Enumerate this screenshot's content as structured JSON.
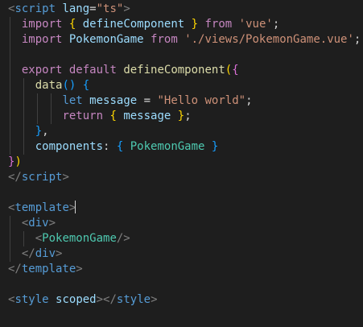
{
  "editor": {
    "language": "vue",
    "cursor_line": 13,
    "lines": [
      {
        "indent": 0,
        "tokens": [
          {
            "t": "<",
            "c": "#808080"
          },
          {
            "t": "script",
            "c": "#569cd6"
          },
          {
            "t": " ",
            "c": "#d4d4d4"
          },
          {
            "t": "lang",
            "c": "#9cdcfe"
          },
          {
            "t": "=",
            "c": "#d4d4d4"
          },
          {
            "t": "\"ts\"",
            "c": "#ce9178"
          },
          {
            "t": ">",
            "c": "#808080"
          }
        ]
      },
      {
        "indent": 1,
        "tokens": [
          {
            "t": "import",
            "c": "#c586c0"
          },
          {
            "t": " ",
            "c": "#d4d4d4"
          },
          {
            "t": "{",
            "c": "#ffd700"
          },
          {
            "t": " ",
            "c": "#d4d4d4"
          },
          {
            "t": "defineComponent",
            "c": "#9cdcfe"
          },
          {
            "t": " ",
            "c": "#d4d4d4"
          },
          {
            "t": "}",
            "c": "#ffd700"
          },
          {
            "t": " ",
            "c": "#d4d4d4"
          },
          {
            "t": "from",
            "c": "#c586c0"
          },
          {
            "t": " ",
            "c": "#d4d4d4"
          },
          {
            "t": "'vue'",
            "c": "#ce9178"
          },
          {
            "t": ";",
            "c": "#d4d4d4"
          }
        ]
      },
      {
        "indent": 1,
        "tokens": [
          {
            "t": "import",
            "c": "#c586c0"
          },
          {
            "t": " ",
            "c": "#d4d4d4"
          },
          {
            "t": "PokemonGame",
            "c": "#9cdcfe"
          },
          {
            "t": " ",
            "c": "#d4d4d4"
          },
          {
            "t": "from",
            "c": "#c586c0"
          },
          {
            "t": " ",
            "c": "#d4d4d4"
          },
          {
            "t": "'./views/PokemonGame.vue'",
            "c": "#ce9178"
          },
          {
            "t": ";",
            "c": "#d4d4d4"
          }
        ]
      },
      {
        "indent": 1,
        "tokens": []
      },
      {
        "indent": 1,
        "tokens": [
          {
            "t": "export",
            "c": "#c586c0"
          },
          {
            "t": " ",
            "c": "#d4d4d4"
          },
          {
            "t": "default",
            "c": "#c586c0"
          },
          {
            "t": " ",
            "c": "#d4d4d4"
          },
          {
            "t": "defineComponent",
            "c": "#dcdcaa"
          },
          {
            "t": "(",
            "c": "#ffd700"
          },
          {
            "t": "{",
            "c": "#da70d6"
          }
        ]
      },
      {
        "indent": 2,
        "tokens": [
          {
            "t": "data",
            "c": "#dcdcaa"
          },
          {
            "t": "()",
            "c": "#179fff"
          },
          {
            "t": " ",
            "c": "#d4d4d4"
          },
          {
            "t": "{",
            "c": "#179fff"
          }
        ]
      },
      {
        "indent": 4,
        "tokens": [
          {
            "t": "let",
            "c": "#569cd6"
          },
          {
            "t": " ",
            "c": "#d4d4d4"
          },
          {
            "t": "message",
            "c": "#9cdcfe"
          },
          {
            "t": " = ",
            "c": "#d4d4d4"
          },
          {
            "t": "\"Hello world\"",
            "c": "#ce9178"
          },
          {
            "t": ";",
            "c": "#d4d4d4"
          }
        ]
      },
      {
        "indent": 4,
        "tokens": [
          {
            "t": "return",
            "c": "#c586c0"
          },
          {
            "t": " ",
            "c": "#d4d4d4"
          },
          {
            "t": "{",
            "c": "#ffd700"
          },
          {
            "t": " ",
            "c": "#d4d4d4"
          },
          {
            "t": "message",
            "c": "#9cdcfe"
          },
          {
            "t": " ",
            "c": "#d4d4d4"
          },
          {
            "t": "}",
            "c": "#ffd700"
          },
          {
            "t": ";",
            "c": "#d4d4d4"
          }
        ]
      },
      {
        "indent": 2,
        "tokens": [
          {
            "t": "}",
            "c": "#179fff"
          },
          {
            "t": ",",
            "c": "#d4d4d4"
          }
        ]
      },
      {
        "indent": 2,
        "tokens": [
          {
            "t": "components",
            "c": "#9cdcfe"
          },
          {
            "t": ": ",
            "c": "#d4d4d4"
          },
          {
            "t": "{",
            "c": "#179fff"
          },
          {
            "t": " ",
            "c": "#d4d4d4"
          },
          {
            "t": "PokemonGame",
            "c": "#4ec9b0"
          },
          {
            "t": " ",
            "c": "#d4d4d4"
          },
          {
            "t": "}",
            "c": "#179fff"
          }
        ]
      },
      {
        "indent": 0,
        "tokens": [
          {
            "t": "}",
            "c": "#da70d6"
          },
          {
            "t": ")",
            "c": "#ffd700"
          }
        ]
      },
      {
        "indent": 0,
        "tokens": [
          {
            "t": "</",
            "c": "#808080"
          },
          {
            "t": "script",
            "c": "#569cd6"
          },
          {
            "t": ">",
            "c": "#808080"
          }
        ]
      },
      {
        "indent": 0,
        "tokens": []
      },
      {
        "indent": 0,
        "tokens": [
          {
            "t": "<",
            "c": "#808080"
          },
          {
            "t": "template",
            "c": "#569cd6"
          },
          {
            "t": ">",
            "c": "#808080"
          }
        ]
      },
      {
        "indent": 1,
        "tokens": [
          {
            "t": "<",
            "c": "#808080"
          },
          {
            "t": "div",
            "c": "#569cd6"
          },
          {
            "t": ">",
            "c": "#808080"
          }
        ]
      },
      {
        "indent": 2,
        "tokens": [
          {
            "t": "<",
            "c": "#808080"
          },
          {
            "t": "PokemonGame",
            "c": "#4ec9b0"
          },
          {
            "t": "/>",
            "c": "#808080"
          }
        ]
      },
      {
        "indent": 1,
        "tokens": [
          {
            "t": "</",
            "c": "#808080"
          },
          {
            "t": "div",
            "c": "#569cd6"
          },
          {
            "t": ">",
            "c": "#808080"
          }
        ]
      },
      {
        "indent": 0,
        "tokens": [
          {
            "t": "</",
            "c": "#808080"
          },
          {
            "t": "template",
            "c": "#569cd6"
          },
          {
            "t": ">",
            "c": "#808080"
          }
        ]
      },
      {
        "indent": 0,
        "tokens": []
      },
      {
        "indent": 0,
        "tokens": [
          {
            "t": "<",
            "c": "#808080"
          },
          {
            "t": "style",
            "c": "#569cd6"
          },
          {
            "t": " ",
            "c": "#d4d4d4"
          },
          {
            "t": "scoped",
            "c": "#9cdcfe"
          },
          {
            "t": "></",
            "c": "#808080"
          },
          {
            "t": "style",
            "c": "#569cd6"
          },
          {
            "t": ">",
            "c": "#808080"
          }
        ]
      }
    ]
  }
}
